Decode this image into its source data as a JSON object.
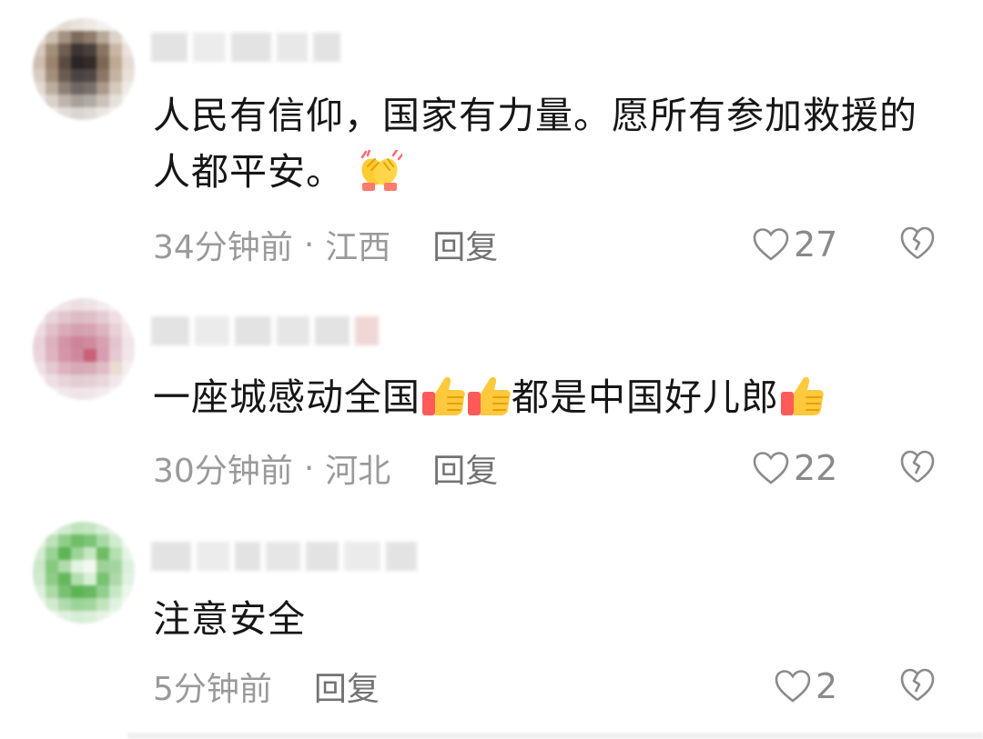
{
  "comments": [
    {
      "text": "人民有信仰，国家有力量。愿所有参加救援的人都平安。",
      "emoji_after": "clapping-hands",
      "time": "34分钟前",
      "location": "江西",
      "reply_label": "回复",
      "likes": "27"
    },
    {
      "text_parts": [
        "一座城感动全国",
        "都是中国好儿郎"
      ],
      "emoji": "thumbs-up",
      "time": "30分钟前",
      "location": "河北",
      "reply_label": "回复",
      "likes": "22"
    },
    {
      "text": "注意安全",
      "time": "5分钟前",
      "reply_label": "回复",
      "likes": "2"
    }
  ],
  "location_separator": "·",
  "colors": {
    "text": "#161616",
    "meta": "#9a9a9a",
    "reply": "#737373",
    "icon": "#8a8a8a"
  }
}
